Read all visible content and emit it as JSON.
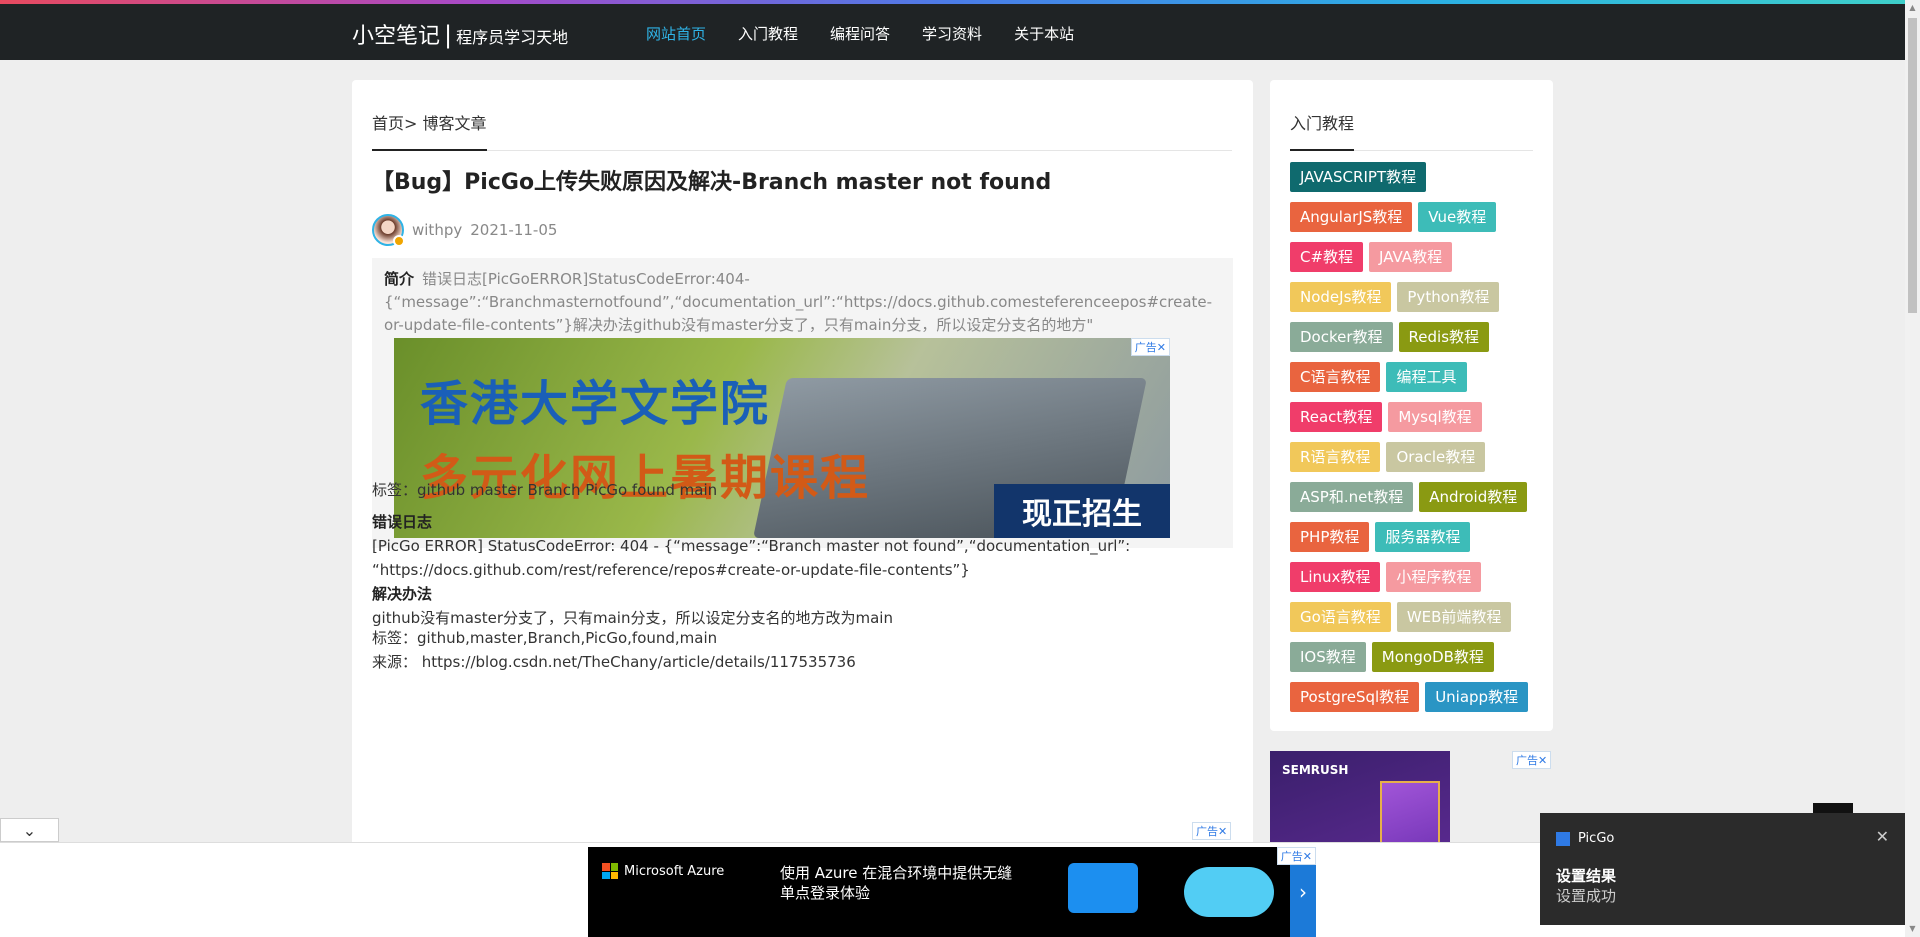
{
  "nav": {
    "brand": "小空笔记",
    "separator": "|",
    "subtitle": "程序员学习天地",
    "items": [
      "网站首页",
      "入门教程",
      "编程问答",
      "学习资料",
      "关于本站"
    ]
  },
  "breadcrumb": {
    "home": "首页>",
    "current": "博客文章"
  },
  "article": {
    "title": "【Bug】PicGo上传失败原因及解决-Branch master not found",
    "author": "withpy",
    "date": "2021-11-05",
    "summary_label": "简介",
    "summary": "错误日志[PicGoERROR]StatusCodeError:404-{“message”:“Branchmasternotfound”,“documentation_url”:“https://docs.github.comesteferenceepos#create-or-update-file-contents”}解决办法github没有master分支了，只有main分支，所以设定分支名的地方\"",
    "tags_line": "标签：github master Branch PicGo found main",
    "error_heading": "错误日志",
    "error_line1": "[PicGo ERROR] StatusCodeError: 404 - {“message”:“Branch master not found”,“documentation_url”:",
    "error_line2": "“https://docs.github.com/rest/reference/repos#create-or-update-file-contents”}",
    "fix_heading": "解决办法",
    "fix_text": "github没有master分支了，只有main分支，所以设定分支名的地方改为main",
    "tags_line2": "标签：github,master,Branch,PicGo,found,main",
    "source": "来源：  https://blog.csdn.net/TheChany/article/details/117535736"
  },
  "ad_main": {
    "mark": "广告✕",
    "line1": "香港大学文学院",
    "line2": "多元化网上暑期课程",
    "cta": "现正招生"
  },
  "sidebar": {
    "heading": "入门教程",
    "tags": [
      {
        "label": "JAVASCRIPT教程",
        "color": "#0f6a6e"
      },
      {
        "label": "AngularJS教程",
        "color": "#e9643f"
      },
      {
        "label": "Vue教程",
        "color": "#3dbcb8"
      },
      {
        "label": "C#教程",
        "color": "#f03d6a"
      },
      {
        "label": "JAVA教程",
        "color": "#f59aa0"
      },
      {
        "label": "NodeJs教程",
        "color": "#f1c85a"
      },
      {
        "label": "Python教程",
        "color": "#c9c7a1"
      },
      {
        "label": "Docker教程",
        "color": "#8aab98"
      },
      {
        "label": "Redis教程",
        "color": "#8a9a12"
      },
      {
        "label": "C语言教程",
        "color": "#e9643f"
      },
      {
        "label": "编程工具",
        "color": "#3dbcb8"
      },
      {
        "label": "React教程",
        "color": "#f03d6a"
      },
      {
        "label": "Mysql教程",
        "color": "#f59aa0"
      },
      {
        "label": "R语言教程",
        "color": "#f1c85a"
      },
      {
        "label": "Oracle教程",
        "color": "#c9c7a1"
      },
      {
        "label": "ASP和.net教程",
        "color": "#8aab98"
      },
      {
        "label": "Android教程",
        "color": "#8a9a12"
      },
      {
        "label": "PHP教程",
        "color": "#e9643f"
      },
      {
        "label": "服务器教程",
        "color": "#3dbcb8"
      },
      {
        "label": "Linux教程",
        "color": "#f03d6a"
      },
      {
        "label": "小程序教程",
        "color": "#f59aa0"
      },
      {
        "label": "Go语言教程",
        "color": "#f1c85a"
      },
      {
        "label": "WEB前端教程",
        "color": "#c9c7a1"
      },
      {
        "label": "IOS教程",
        "color": "#8aab98"
      },
      {
        "label": "MongoDB教程",
        "color": "#8a9a12"
      },
      {
        "label": "PostgreSql教程",
        "color": "#e9643f"
      },
      {
        "label": "Uniapp教程",
        "color": "#2a95c4"
      }
    ]
  },
  "side_ad": {
    "brand": "SEMRUSH",
    "mark": "广告✕"
  },
  "bottom_ad": {
    "brand": "Microsoft Azure",
    "copy": "使用 Azure 在混合环境中提供无缝单点登录体验",
    "mark": "广告✕",
    "arrow": "›"
  },
  "toast": {
    "app": "PicGo",
    "title": "设置结果",
    "message": "设置成功",
    "close": "✕"
  },
  "collapse": "⌄"
}
